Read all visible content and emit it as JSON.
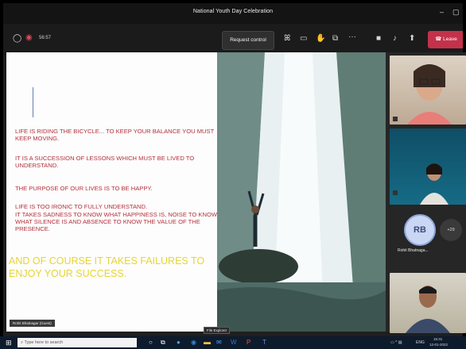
{
  "window": {
    "title": "National Youth Day Celebration"
  },
  "toolbar": {
    "timer": "56:57",
    "request_control": "Request control",
    "leave": "Leave"
  },
  "slide": {
    "quote1": "LIFE IS RIDING THE BICYCLE... TO KEEP YOUR BALANCE YOU MUST KEEP MOVING.",
    "quote2": "IT IS A SUCCESSION OF LESSONS WHICH MUST BE LIVED TO UNDERSTAND.",
    "quote3": "THE PURPOSE OF OUR LIVES IS TO BE HAPPY.",
    "quote4": "LIFE IS TOO IRONIC TO FULLY UNDERSTAND.",
    "quote5": "IT TAKES SADNESS TO KNOW WHAT HAPPINESS IS, NOISE TO KNOW WHAT SILENCE IS AND ABSENCE TO KNOW THE VALUE OF THE PRESENCE.",
    "quote6": "AND OF COURSE IT TAKES FAILURES TO ENJOY YOUR SUCCESS.",
    "presenter_tag": "Rohit Bhatnagar (Guest)"
  },
  "participants": {
    "avatar_initials": "RB",
    "more_count": "+29",
    "rb_name": "Rohit Bhatnaga..."
  },
  "taskbar": {
    "search_placeholder": "Type here to search",
    "tooltip": "File Explorer",
    "lang": "ENG",
    "time": "15:31",
    "date": "12-01-2022"
  },
  "colors": {
    "leave_red": "#c4314b",
    "quote_red": "#b2303b",
    "quote_yellow": "#e6d534"
  }
}
